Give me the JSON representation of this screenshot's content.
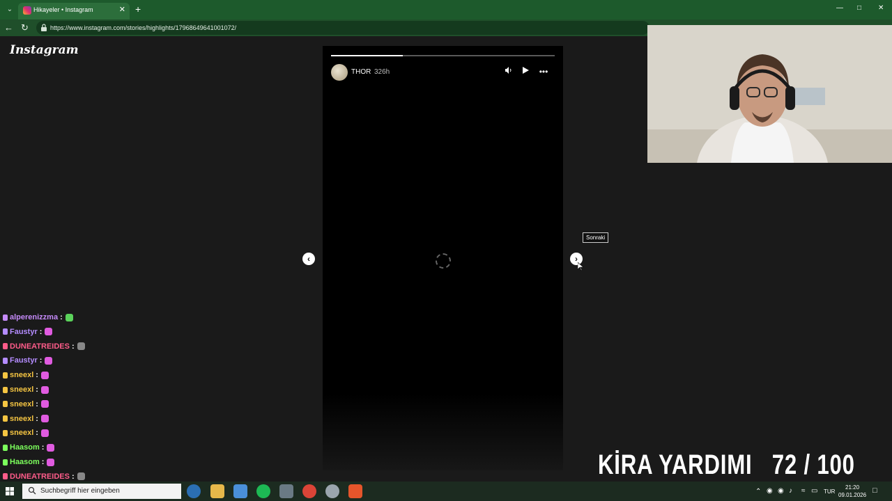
{
  "browser": {
    "tab_title": "Hikayeler • Instagram",
    "url": "https://www.instagram.com/stories/highlights/17968649641001072/"
  },
  "page": {
    "logo": "Instagram",
    "story": {
      "username": "THOR",
      "time": "326h",
      "progress_fraction": 0.32
    },
    "next_tooltip": "Sonraki"
  },
  "chat": {
    "messages": [
      {
        "user": "alperenizzma",
        "color": "#c58af9",
        "emote_color": "#5bd35b"
      },
      {
        "user": "Faustyr",
        "color": "#b48cff",
        "emote_color": "#e05be0"
      },
      {
        "user": "DUNEATREIDES",
        "color": "#ff5c8a",
        "emote_color": "#888888"
      },
      {
        "user": "Faustyr",
        "color": "#b48cff",
        "emote_color": "#e05be0"
      },
      {
        "user": "sneexl",
        "color": "#f5c542",
        "emote_color": "#e05be0"
      },
      {
        "user": "sneexl",
        "color": "#f5c542",
        "emote_color": "#e05be0"
      },
      {
        "user": "sneexl",
        "color": "#f5c542",
        "emote_color": "#e05be0"
      },
      {
        "user": "sneexl",
        "color": "#f5c542",
        "emote_color": "#e05be0"
      },
      {
        "user": "sneexl",
        "color": "#f5c542",
        "emote_color": "#e05be0"
      },
      {
        "user": "Haasom",
        "color": "#7cff5c",
        "emote_color": "#e05be0"
      },
      {
        "user": "Haasom",
        "color": "#7cff5c",
        "emote_color": "#e05be0"
      },
      {
        "user": "DUNEATREIDES",
        "color": "#ff5c8a",
        "emote_color": "#888888"
      }
    ],
    "separator": ":"
  },
  "overlay": {
    "title": "KİRA YARDIMI",
    "progress": "72 / 100"
  },
  "taskbar": {
    "search_placeholder": "Suchbegriff hier eingeben",
    "language": "TUR",
    "time": "21:20",
    "date": "09.01.2026"
  },
  "colors": {
    "tabbar": "#1d5a2c",
    "page_bg": "#1a1a1a",
    "story_bg": "#000000"
  }
}
